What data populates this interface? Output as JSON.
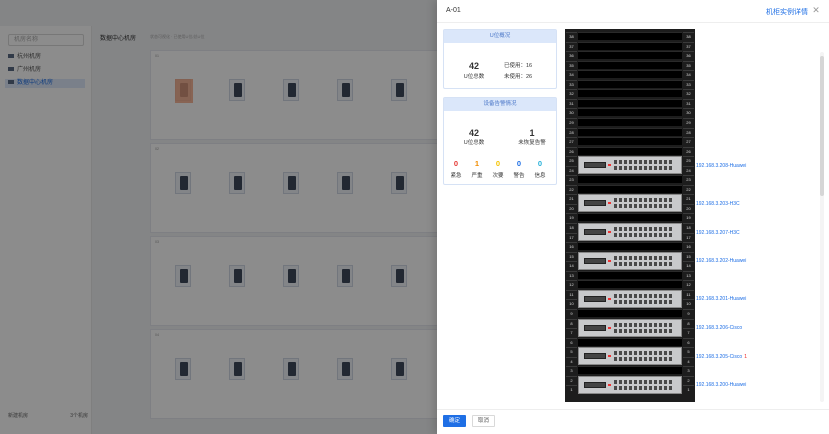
{
  "background": {
    "search_placeholder": "机房名称",
    "tree": [
      {
        "label": "杭州机房",
        "selected": false
      },
      {
        "label": "广州机房",
        "selected": false
      },
      {
        "label": "数据中心机房",
        "selected": true
      }
    ],
    "header_title": "数据中心机房",
    "header_sub": "状态可视化 · 已使用U位/总U位",
    "new_room_label": "新建机房",
    "room_count_label": "3个机房",
    "rows": [
      {
        "label": "01"
      },
      {
        "label": "02"
      },
      {
        "label": "03"
      },
      {
        "label": "04"
      }
    ]
  },
  "drawer": {
    "title": "A-01",
    "detail_link": "机柜实例详情",
    "close_icon": "close-icon",
    "u_card": {
      "title": "U位概况",
      "total": "42",
      "total_label": "U位总数",
      "used": "已使用：16",
      "free": "未使用：26"
    },
    "alarm_card": {
      "title": "设备告警情况",
      "total": "42",
      "total_label": "U位总数",
      "unrecovered": "1",
      "unrecovered_label": "未恢复告警",
      "levels": [
        {
          "count": "0",
          "label": "紧急",
          "color": "#e53935"
        },
        {
          "count": "1",
          "label": "严重",
          "color": "#f08c00"
        },
        {
          "count": "0",
          "label": "次要",
          "color": "#f5c400"
        },
        {
          "count": "0",
          "label": "警告",
          "color": "#1f6fe5"
        },
        {
          "count": "0",
          "label": "信息",
          "color": "#26b0d9"
        }
      ]
    },
    "rack": {
      "units": 38,
      "devices": [
        {
          "top_u": 25,
          "label": "192.168.3.208-Huawei",
          "alarm": false
        },
        {
          "top_u": 21,
          "label": "192.168.3.203-H3C",
          "alarm": false
        },
        {
          "top_u": 18,
          "label": "192.168.3.207-H3C",
          "alarm": false
        },
        {
          "top_u": 15,
          "label": "192.168.3.202-Huawei",
          "alarm": false
        },
        {
          "top_u": 11,
          "label": "192.168.3.201-Huawei",
          "alarm": false
        },
        {
          "top_u": 8,
          "label": "192.168.3.206-Cisco",
          "alarm": false
        },
        {
          "top_u": 5,
          "label": "192.168.3.205-Cisco",
          "alarm": true,
          "alarm_count": "1"
        },
        {
          "top_u": 2,
          "label": "192.168.3.200-Huawei",
          "alarm": false
        }
      ]
    },
    "ok_label": "确定",
    "cancel_label": "取消"
  }
}
